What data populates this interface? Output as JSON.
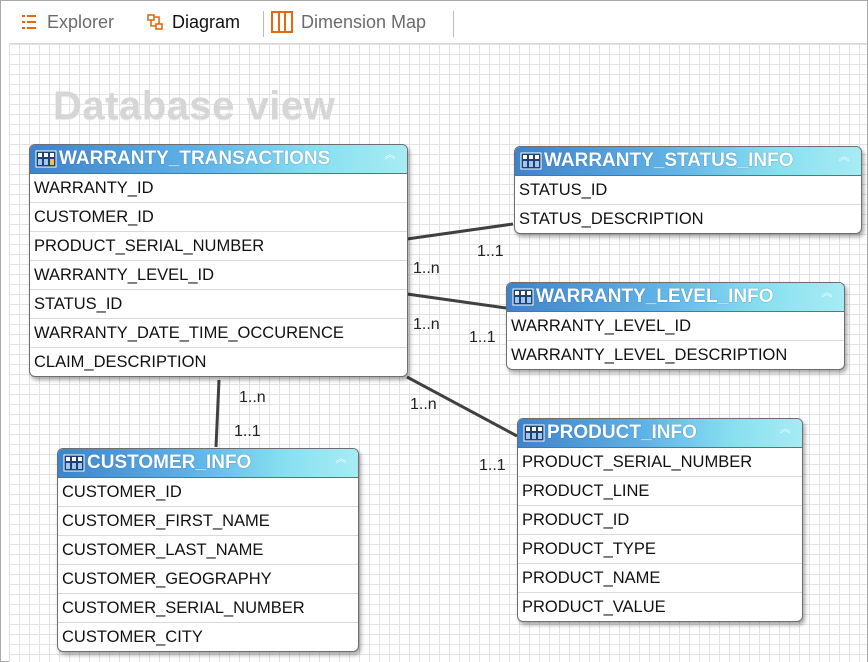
{
  "tabs": [
    {
      "label": "Explorer"
    },
    {
      "label": "Diagram"
    },
    {
      "label": "Dimension Map"
    }
  ],
  "watermark": "Database view",
  "tables": {
    "warranty_transactions": {
      "title": "WARRANTY_TRANSACTIONS",
      "fields": [
        "WARRANTY_ID",
        "CUSTOMER_ID",
        "PRODUCT_SERIAL_NUMBER",
        "WARRANTY_LEVEL_ID",
        "STATUS_ID",
        "WARRANTY_DATE_TIME_OCCURENCE",
        "CLAIM_DESCRIPTION"
      ]
    },
    "warranty_status_info": {
      "title": "WARRANTY_STATUS_INFO",
      "fields": [
        "STATUS_ID",
        "STATUS_DESCRIPTION"
      ]
    },
    "warranty_level_info": {
      "title": "WARRANTY_LEVEL_INFO",
      "fields": [
        "WARRANTY_LEVEL_ID",
        "WARRANTY_LEVEL_DESCRIPTION"
      ]
    },
    "product_info": {
      "title": "PRODUCT_INFO",
      "fields": [
        "PRODUCT_SERIAL_NUMBER",
        "PRODUCT_LINE",
        "PRODUCT_ID",
        "PRODUCT_TYPE",
        "PRODUCT_NAME",
        "PRODUCT_VALUE"
      ]
    },
    "customer_info": {
      "title": "CUSTOMER_INFO",
      "fields": [
        "CUSTOMER_ID",
        "CUSTOMER_FIRST_NAME",
        "CUSTOMER_LAST_NAME",
        "CUSTOMER_GEOGRAPHY",
        "CUSTOMER_SERIAL_NUMBER",
        "CUSTOMER_CITY"
      ]
    }
  },
  "relationships": {
    "status": {
      "from": "1..n",
      "to": "1..1"
    },
    "level": {
      "from": "1..n",
      "to": "1..1"
    },
    "product": {
      "from": "1..n",
      "to": "1..1"
    },
    "customer": {
      "from": "1..n",
      "to": "1..1"
    }
  },
  "colors": {
    "header_start": "#3d83cc",
    "header_end": "#a7ecf4",
    "accent_orange": "#e46a12"
  }
}
